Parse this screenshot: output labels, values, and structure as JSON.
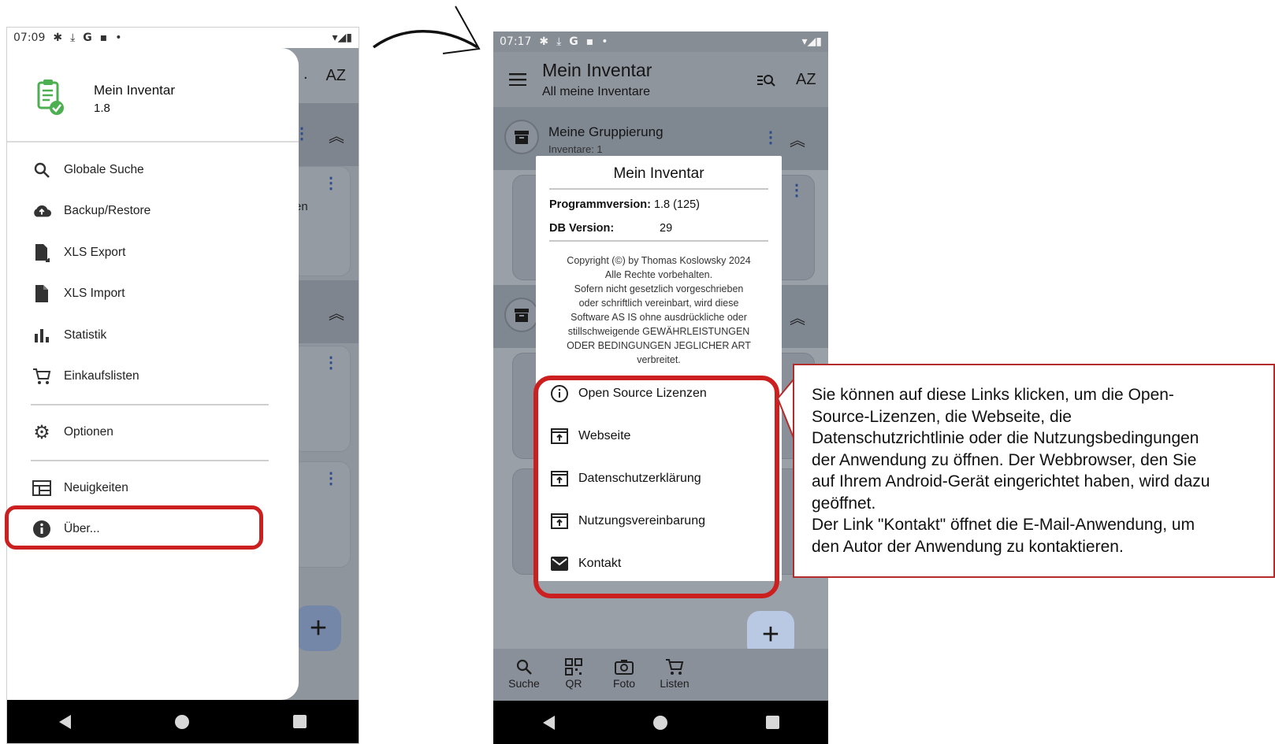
{
  "phone1": {
    "status": {
      "time": "07:09",
      "icons": [
        "gear-icon",
        "download-icon",
        "google-icon",
        "sd-card-icon",
        "dot-icon"
      ],
      "right": "▾◢▮"
    },
    "background": {
      "sort_label": "AZ",
      "partial_text": "en"
    },
    "drawer": {
      "app_name": "Mein Inventar",
      "app_version": "1.8",
      "items": [
        {
          "label": "Globale Suche",
          "icon": "search-icon"
        },
        {
          "label": "Backup/Restore",
          "icon": "cloud-upload-icon"
        },
        {
          "label": "XLS Export",
          "icon": "file-export-icon"
        },
        {
          "label": "XLS Import",
          "icon": "file-icon"
        },
        {
          "label": "Statistik",
          "icon": "bar-chart-icon"
        },
        {
          "label": "Einkaufslisten",
          "icon": "cart-icon"
        },
        {
          "label": "Optionen",
          "icon": "gear-icon"
        },
        {
          "label": "Neuigkeiten",
          "icon": "news-icon"
        },
        {
          "label": "Über...",
          "icon": "info-icon"
        }
      ]
    }
  },
  "phone2": {
    "status": {
      "time": "07:17",
      "icons": [
        "gear-icon",
        "download-icon",
        "google-icon",
        "sd-card-icon",
        "dot-icon"
      ],
      "right": "▾◢▮"
    },
    "header": {
      "title": "Mein Inventar",
      "subtitle": "All meine Inventare",
      "sort_label": "AZ"
    },
    "group": {
      "name": "Meine Gruppierung",
      "count": "Inventare: 1"
    },
    "dialog": {
      "title": "Mein Inventar",
      "program_version_label": "Programmversion:",
      "program_version_value": "1.8 (125)",
      "db_version_label": "DB Version:",
      "db_version_value": "29",
      "copyright_lines": [
        "Copyright (©) by Thomas Koslowsky 2024",
        "Alle Rechte vorbehalten.",
        "Sofern nicht gesetzlich vorgeschrieben",
        "oder schriftlich vereinbart, wird diese",
        "Software AS IS ohne ausdrückliche oder",
        "stillschweigende GEWÄHRLEISTUNGEN",
        "ODER BEDINGUNGEN JEGLICHER ART",
        "verbreitet."
      ],
      "links": [
        {
          "label": "Open Source Lizenzen",
          "icon": "info-outline-icon"
        },
        {
          "label": "Webseite",
          "icon": "open-external-icon"
        },
        {
          "label": "Datenschutzerklärung",
          "icon": "open-external-icon"
        },
        {
          "label": "Nutzungsvereinbarung",
          "icon": "open-external-icon"
        },
        {
          "label": "Kontakt",
          "icon": "mail-icon"
        }
      ]
    },
    "bottom_nav": [
      {
        "label": "Suche",
        "icon": "search-icon"
      },
      {
        "label": "QR",
        "icon": "qr-code-icon"
      },
      {
        "label": "Foto",
        "icon": "camera-icon"
      },
      {
        "label": "Listen",
        "icon": "cart-icon"
      }
    ]
  },
  "callout": {
    "lines": [
      "Sie können auf diese Links klicken, um die Open-",
      "Source-Lizenzen, die Webseite, die",
      "Datenschutzrichtlinie oder die Nutzungsbedingungen",
      "der Anwendung zu öffnen. Der Webbrowser, den Sie",
      "auf Ihrem Android-Gerät eingerichtet haben, wird dazu",
      "geöffnet.",
      "Der Link \"Kontakt\" öffnet die E-Mail-Anwendung, um",
      "den Autor der Anwendung zu kontaktieren."
    ]
  },
  "colors": {
    "highlight": "#cc1f1f",
    "accent": "#4caf50",
    "link_blue": "#2b4a8c"
  }
}
